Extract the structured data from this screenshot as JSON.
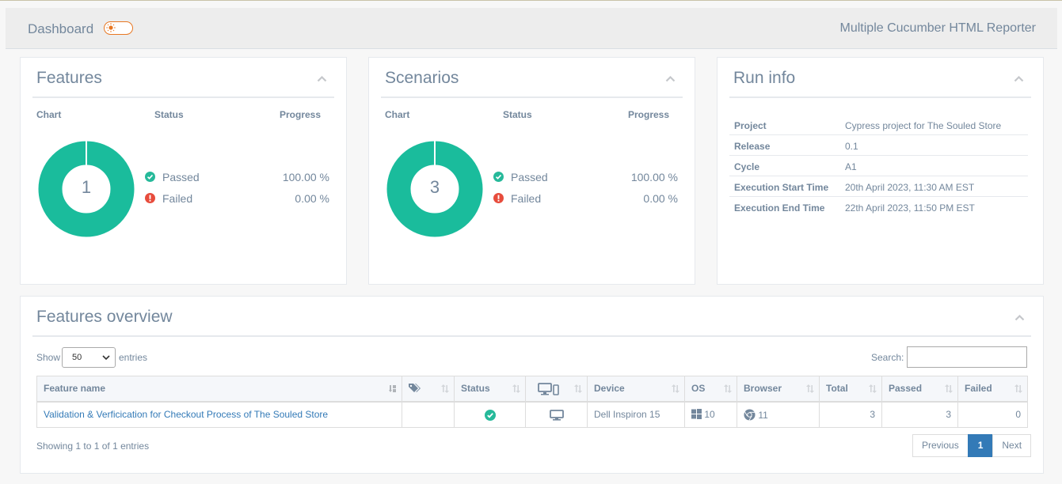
{
  "header": {
    "title": "Dashboard",
    "reporter": "Multiple Cucumber HTML Reporter"
  },
  "features": {
    "title": "Features",
    "columns": [
      "Chart",
      "Status",
      "Progress"
    ],
    "total": "1",
    "rows": [
      {
        "label": "Passed",
        "progress": "100.00 %",
        "color": "#26b99a"
      },
      {
        "label": "Failed",
        "progress": "0.00 %",
        "color": "#e74c3c"
      }
    ]
  },
  "scenarios": {
    "title": "Scenarios",
    "columns": [
      "Chart",
      "Status",
      "Progress"
    ],
    "total": "3",
    "rows": [
      {
        "label": "Passed",
        "progress": "100.00 %",
        "color": "#26b99a"
      },
      {
        "label": "Failed",
        "progress": "0.00 %",
        "color": "#e74c3c"
      }
    ]
  },
  "run_info": {
    "title": "Run info",
    "rows": [
      {
        "key": "Project",
        "value": "Cypress project for The Souled Store"
      },
      {
        "key": "Release",
        "value": "0.1"
      },
      {
        "key": "Cycle",
        "value": "A1"
      },
      {
        "key": "Execution Start Time",
        "value": "20th April 2023, 11:30 AM EST"
      },
      {
        "key": "Execution End Time",
        "value": "22th April 2023, 11:50 PM EST"
      }
    ]
  },
  "overview": {
    "title": "Features overview",
    "show_label": "Show",
    "entries_value": "50",
    "entries_label": "entries",
    "search_label": "Search:",
    "search_value": "",
    "headers": {
      "feature": "Feature name",
      "status": "Status",
      "device": "Device",
      "os": "OS",
      "browser": "Browser",
      "total": "Total",
      "passed": "Passed",
      "failed": "Failed"
    },
    "rows": [
      {
        "feature": "Validation & Verficication for Checkout Process of The Souled Store",
        "device": "Dell Inspiron 15",
        "os_version": "10",
        "browser_version": "11",
        "total": "3",
        "passed": "3",
        "failed": "0"
      }
    ],
    "info": "Showing 1 to 1 of 1 entries",
    "pager": {
      "previous": "Previous",
      "current": "1",
      "next": "Next"
    }
  },
  "colors": {
    "passed": "#26b99a",
    "failed": "#e74c3c",
    "accent": "#337ab7",
    "toggle": "#e87722"
  }
}
